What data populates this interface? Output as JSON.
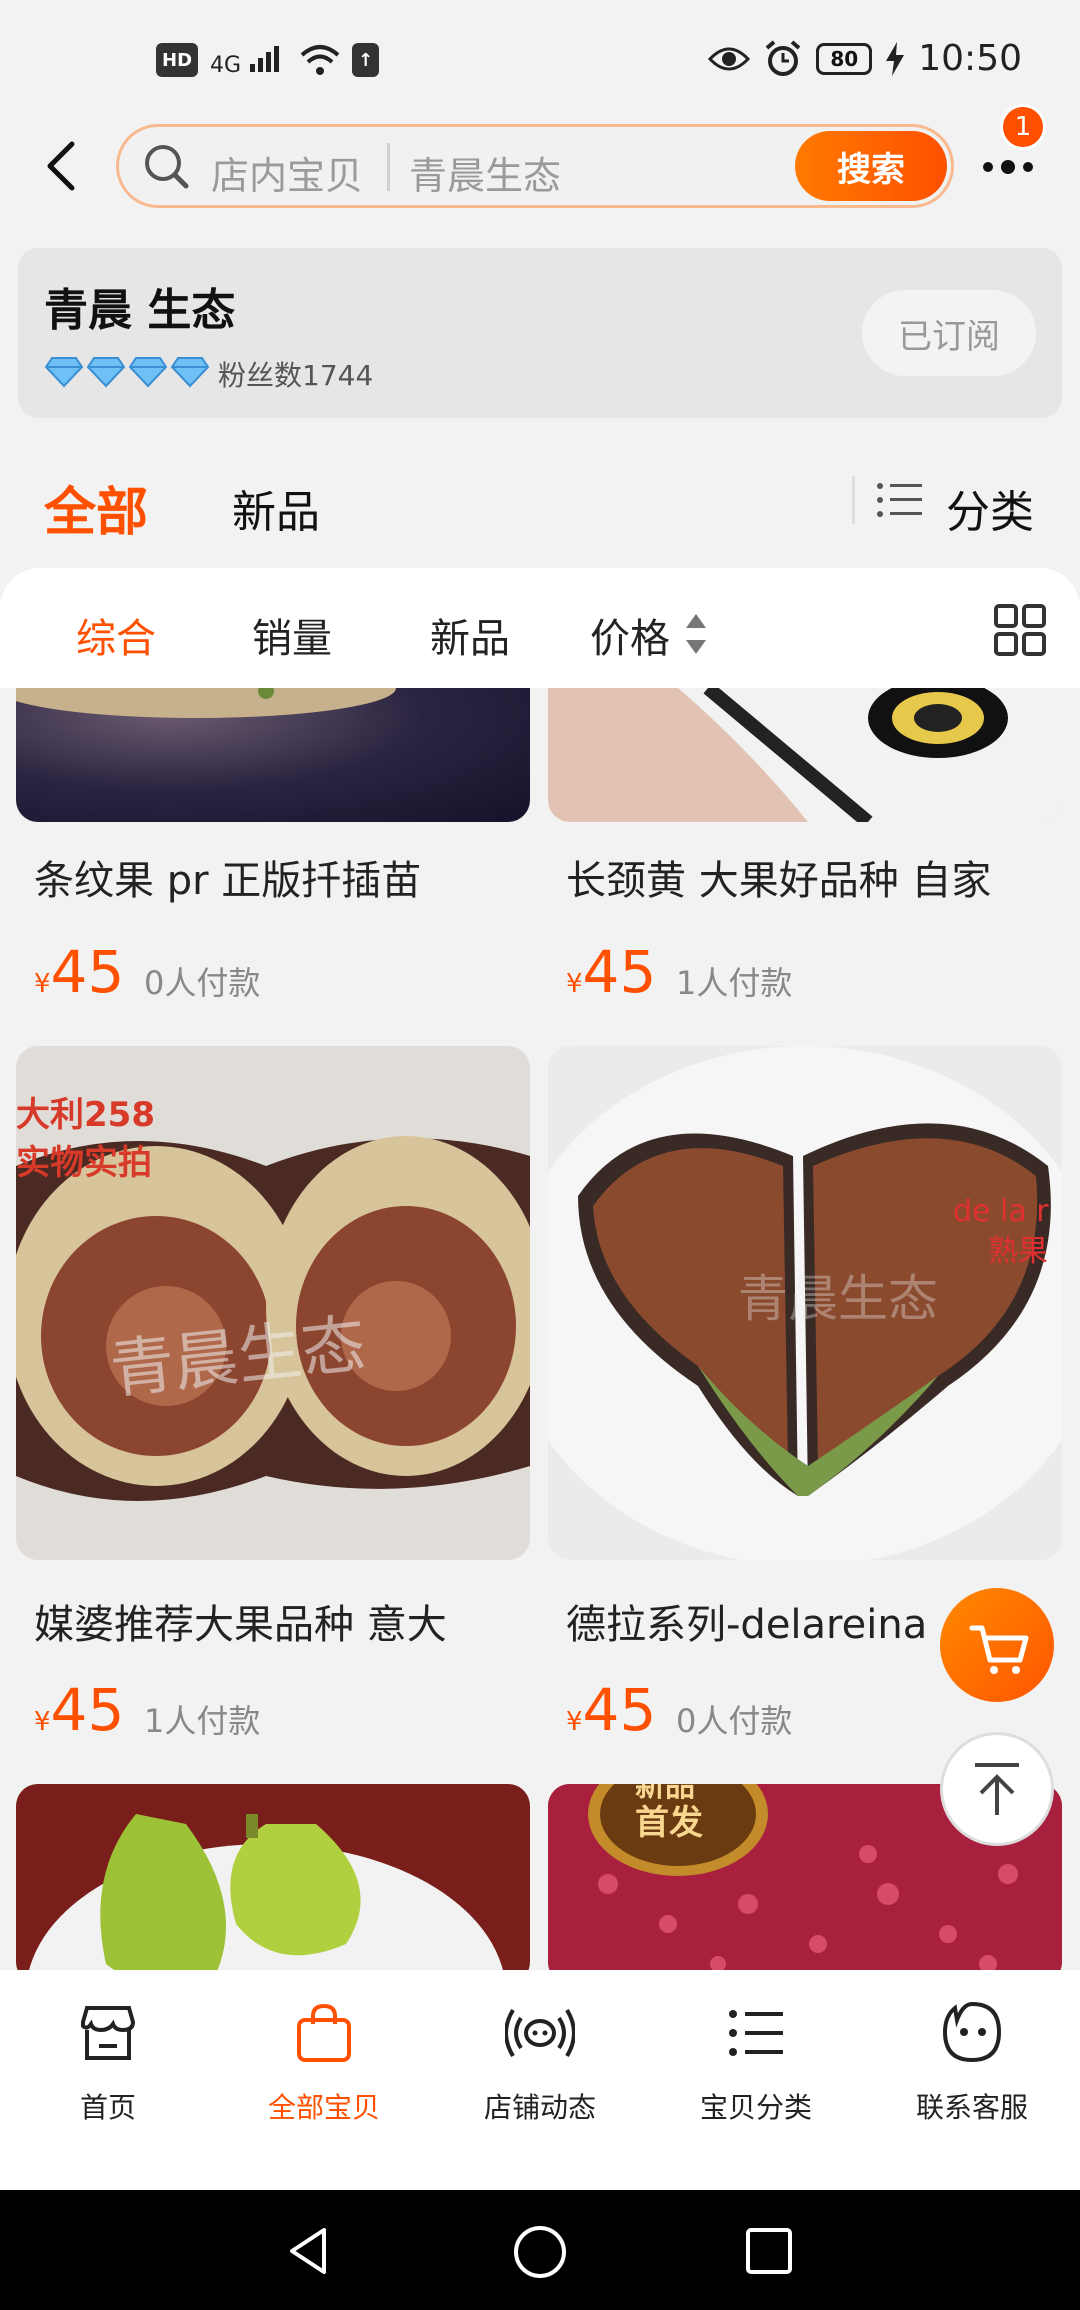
{
  "status_bar": {
    "hd": "HD",
    "network": "4G",
    "battery": "80",
    "time": "10:50"
  },
  "header": {
    "search_placeholder": "店内宝贝",
    "shop_name_in_search": "青晨生态",
    "search_button": "搜索",
    "notification_count": "1"
  },
  "shop": {
    "name": "青晨 生态",
    "fans": "粉丝数1744",
    "subscribe_label": "已订阅"
  },
  "tabs": {
    "all": "全部",
    "new": "新品",
    "category": "分类"
  },
  "sort": {
    "items": [
      "综合",
      "销量",
      "新品",
      "价格"
    ]
  },
  "products": [
    {
      "title": "条纹果 pr 正版扦插苗",
      "currency": "¥",
      "price": "45",
      "paid": "0人付款"
    },
    {
      "title": "长颈黄 大果好品种 自家",
      "currency": "¥",
      "price": "45",
      "paid": "1人付款"
    },
    {
      "title": "媒婆推荐大果品种 意大",
      "currency": "¥",
      "price": "45",
      "paid": "1人付款",
      "image_text": [
        "大利258",
        "实物实拍"
      ],
      "watermark": "青晨生态"
    },
    {
      "title": "德拉系列-delareina",
      "currency": "¥",
      "price": "45",
      "paid": "0人付款",
      "image_text": [
        "de la r",
        "熟果"
      ],
      "watermark": "青晨生态"
    },
    {
      "title": "",
      "currency": "",
      "price": "",
      "paid": ""
    },
    {
      "title": "",
      "currency": "",
      "price": "",
      "paid": "",
      "image_text": [
        "新品",
        "首发"
      ]
    }
  ],
  "bottom_nav": [
    {
      "label": "首页",
      "icon": "store-icon"
    },
    {
      "label": "全部宝贝",
      "icon": "shopping-bag-icon"
    },
    {
      "label": "店铺动态",
      "icon": "broadcast-icon"
    },
    {
      "label": "宝贝分类",
      "icon": "list-icon"
    },
    {
      "label": "联系客服",
      "icon": "chat-icon"
    }
  ],
  "colors": {
    "accent": "#ff5000",
    "background": "#f2f2f2"
  }
}
